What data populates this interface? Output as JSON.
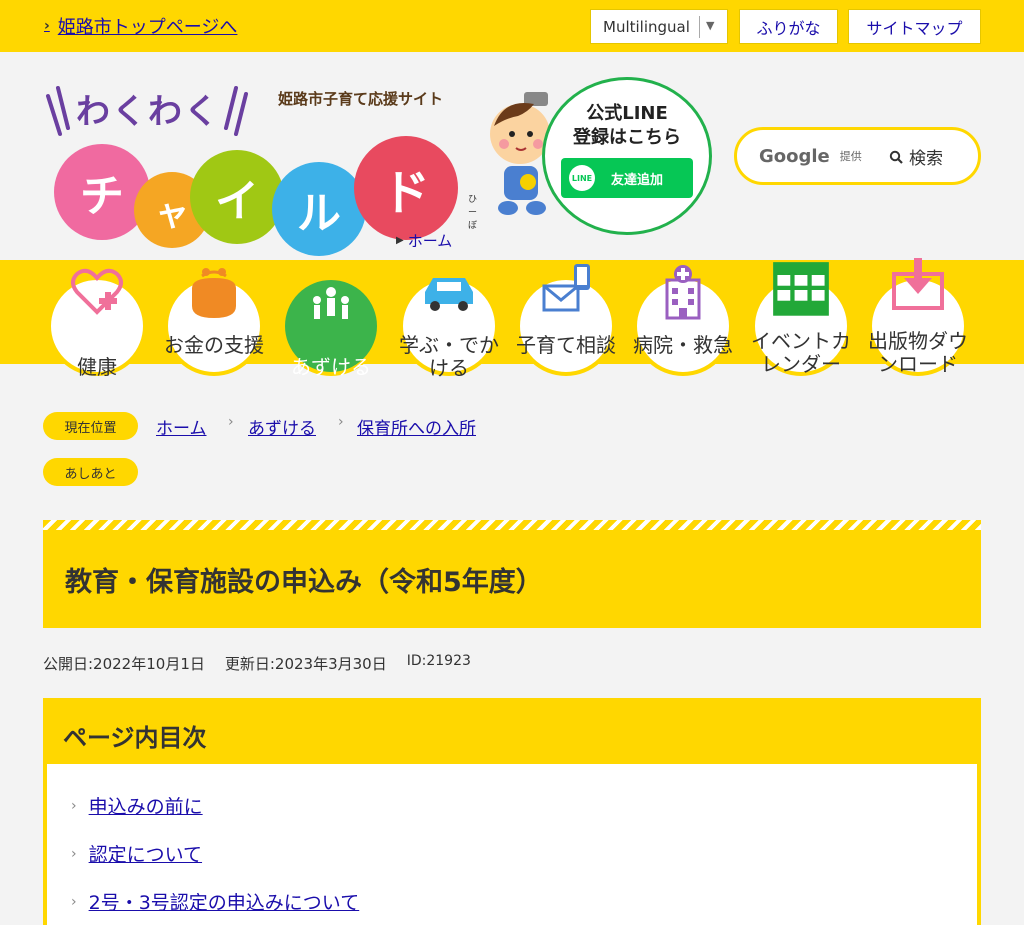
{
  "topbar": {
    "home_link": "姫路市トップページへ",
    "multilingual": "Multilingual",
    "furigana": "ふりがな",
    "sitemap": "サイトマップ"
  },
  "header": {
    "logo_waku": "わくわく",
    "logo_subtitle": "姫路市子育て応援サイト",
    "logo_letters": [
      "チ",
      "ャ",
      "イ",
      "ル",
      "ド"
    ],
    "logo_colors": [
      "#f06aa0",
      "#f5a623",
      "#a0c814",
      "#3db1e8",
      "#e84a5f"
    ],
    "logo_hiibo": "ひーぼ",
    "home_link": "ホーム",
    "line_title_1": "公式LINE",
    "line_title_2": "登録はこちら",
    "line_icon": "LINE",
    "line_button": "友達追加",
    "search_google": "Google",
    "search_teikyo": "提供",
    "search_button": "検索"
  },
  "nav": [
    {
      "label": "健康",
      "icon": "heart-plus-icon"
    },
    {
      "label": "お金の支援",
      "icon": "coin-purse-icon"
    },
    {
      "label": "あずける",
      "icon": "family-icon",
      "active": true
    },
    {
      "label": "学ぶ・でかける",
      "icon": "car-icon"
    },
    {
      "label": "子育て相談",
      "icon": "mail-phone-icon"
    },
    {
      "label": "病院・救急",
      "icon": "hospital-icon"
    },
    {
      "label": "イベントカレンダー",
      "icon": "calendar-icon"
    },
    {
      "label": "出版物ダウンロード",
      "icon": "download-icon"
    }
  ],
  "breadcrumb": {
    "current_label": "現在位置",
    "items": [
      "ホーム",
      "あずける",
      "保育所への入所"
    ],
    "ashiato": "あしあと"
  },
  "page": {
    "title": "教育・保育施設の申込み（令和5年度）",
    "published": "公開日:2022年10月1日",
    "updated": "更新日:2023年3月30日",
    "id": "ID:21923"
  },
  "toc": {
    "title": "ページ内目次",
    "items": [
      "申込みの前に",
      "認定について",
      "2号・3号認定の申込みについて"
    ]
  },
  "colors": {
    "brand_yellow": "#ffd700",
    "link": "#1a0dab",
    "line_green": "#06c755",
    "active_nav": "#3cb44b"
  }
}
